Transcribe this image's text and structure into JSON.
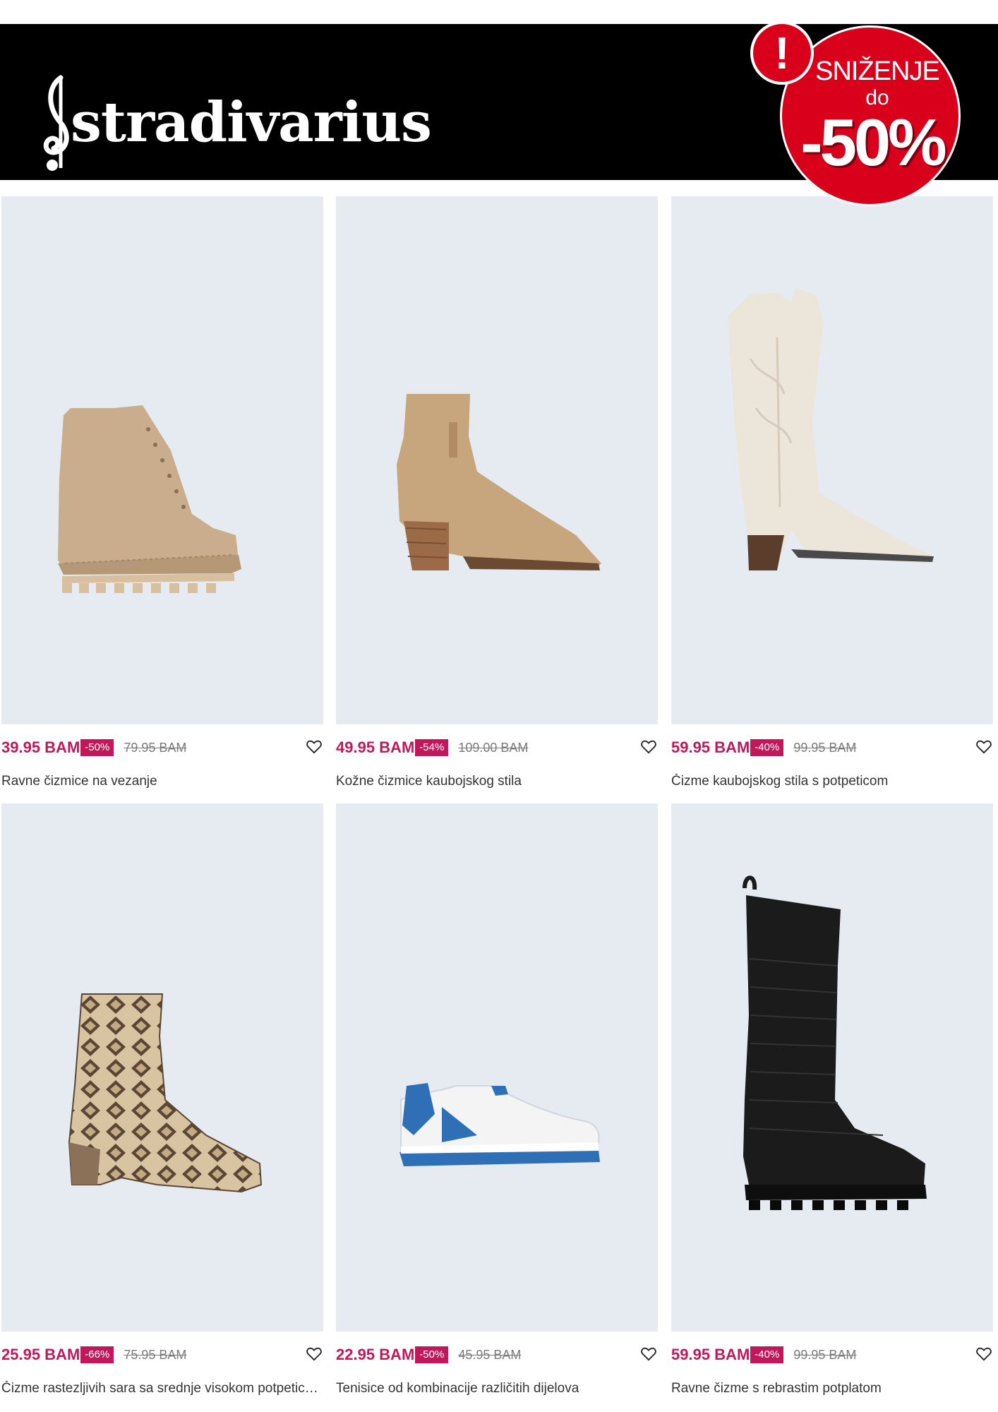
{
  "header": {
    "brand": "stradivarius",
    "sale_badge": {
      "exclamation": "!",
      "title": "SNIŽENJE",
      "do": "do",
      "percent": "-50%"
    }
  },
  "colors": {
    "accent": "#c2185b",
    "sale_red": "#d9001b",
    "header_bg": "#000000",
    "card_bg": "#e5ebf1"
  },
  "products": [
    {
      "price": "39.95 BAM",
      "discount": "-50%",
      "old_price": "79.95 BAM",
      "name": "Ravne čizmice na vezanje",
      "image": "beige-lace-up-boot",
      "icon": "heart-icon"
    },
    {
      "price": "49.95 BAM",
      "discount": "-54%",
      "old_price": "109.00 BAM",
      "name": "Kožne čizmice kaubojskog stila",
      "image": "tan-cowboy-ankle-boot",
      "icon": "heart-icon"
    },
    {
      "price": "59.95 BAM",
      "discount": "-40%",
      "old_price": "99.95 BAM",
      "name": "Čizme kaubojskog stila s potpeticom",
      "image": "white-cowboy-boot",
      "icon": "heart-icon"
    },
    {
      "price": "25.95 BAM",
      "discount": "-66%",
      "old_price": "75.95 BAM",
      "name": "Čizme rastezljivih sara sa srednje visokom potpeticom",
      "image": "snake-print-ankle-boot",
      "icon": "heart-icon"
    },
    {
      "price": "22.95 BAM",
      "discount": "-50%",
      "old_price": "45.95 BAM",
      "name": "Tenisice od kombinacije različitih dijelova",
      "image": "white-blue-sneaker",
      "icon": "heart-icon"
    },
    {
      "price": "59.95 BAM",
      "discount": "-40%",
      "old_price": "99.95 BAM",
      "name": "Ravne čizme s rebrastim potplatom",
      "image": "black-croc-knee-boot",
      "icon": "heart-icon"
    }
  ]
}
